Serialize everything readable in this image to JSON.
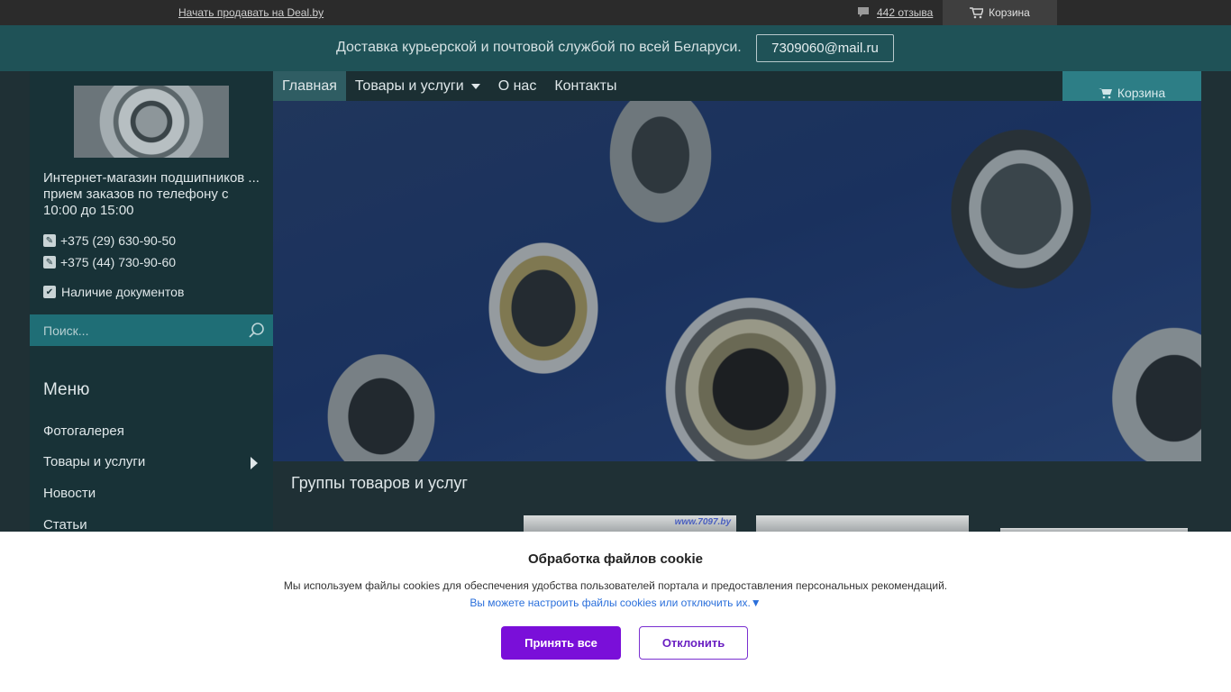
{
  "topbar": {
    "sell_link": "Начать продавать на Deal.by",
    "reviews": "442 отзыва",
    "cart": "Корзина"
  },
  "delivery": {
    "text": "Доставка курьерской и почтовой службой по всей Беларуси.",
    "email": "7309060@mail.ru"
  },
  "sidebar": {
    "shop_name": "Интернет-магазин подшипников ... прием заказов по телефону с 10:00 до 15:00",
    "phones": [
      "+375 (29) 630-90-50",
      "+375 (44) 730-90-60"
    ],
    "documents": "Наличие документов",
    "search_placeholder": "Поиск...",
    "menu_title": "Меню",
    "menu_items": [
      "Фотогалерея",
      "Товары и услуги",
      "Новости",
      "Статьи"
    ]
  },
  "nav": {
    "items": [
      "Главная",
      "Товары и услуги",
      "О нас",
      "Контакты"
    ],
    "cart": "Корзина"
  },
  "main": {
    "groups_title": "Группы товаров и услуг",
    "thumb_watermark": "www.7097.by"
  },
  "cookie": {
    "title": "Обработка файлов cookie",
    "description": "Мы используем файлы cookies для обеспечения удобства пользователей портала и предоставления персональных рекомендаций.",
    "settings_link": "Вы можете настроить файлы cookies или отключить их.▼",
    "accept": "Принять все",
    "decline": "Отклонить"
  }
}
